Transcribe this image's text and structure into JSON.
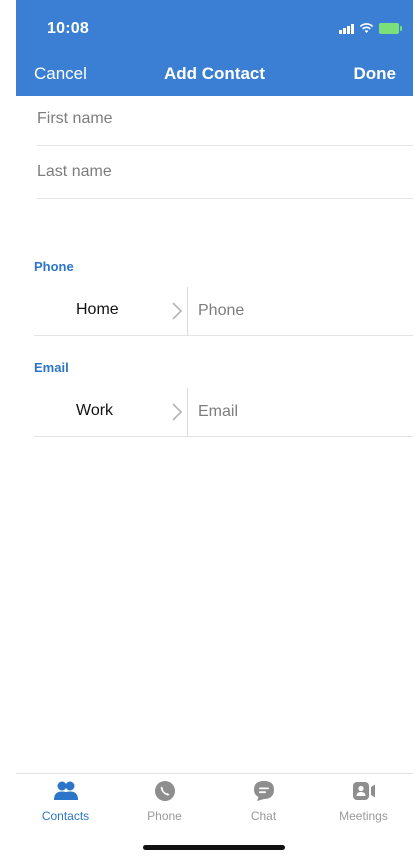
{
  "status_bar": {
    "time": "10:08",
    "icons": [
      "signal-icon",
      "wifi-icon",
      "battery-charging-icon"
    ]
  },
  "nav": {
    "cancel_label": "Cancel",
    "title": "Add Contact",
    "done_label": "Done"
  },
  "form": {
    "first_name": {
      "placeholder": "First name",
      "value": ""
    },
    "last_name": {
      "placeholder": "Last name",
      "value": ""
    }
  },
  "phone_section": {
    "label": "Phone",
    "type_label": "Home",
    "placeholder": "Phone",
    "value": ""
  },
  "email_section": {
    "label": "Email",
    "type_label": "Work",
    "placeholder": "Email",
    "value": ""
  },
  "tabs": [
    {
      "label": "Contacts",
      "icon": "contacts-icon",
      "active": true
    },
    {
      "label": "Phone",
      "icon": "phone-icon",
      "active": false
    },
    {
      "label": "Chat",
      "icon": "chat-icon",
      "active": false
    },
    {
      "label": "Meetings",
      "icon": "meetings-icon",
      "active": false
    }
  ],
  "colors": {
    "header": "#3b7fd4",
    "accent": "#2c75c9",
    "inactive_tab": "#9a9a9a",
    "battery": "#7ce07a"
  }
}
